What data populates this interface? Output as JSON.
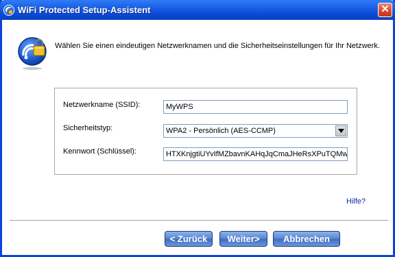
{
  "window": {
    "title": "WiFi Protected Setup-Assistent",
    "close_glyph": "✕"
  },
  "intro": {
    "text": "Wählen Sie einen eindeutigen Netzwerknamen und die Sicherheitseinstellungen für Ihr Netzwerk."
  },
  "form": {
    "ssid_label": "Netzwerkname (SSID):",
    "ssid_value": "MyWPS",
    "security_label": "Sicherheitstyp:",
    "security_value": "WPA2 - Persönlich (AES-CCMP)",
    "key_label": "Kennwort (Schlüssel):",
    "key_value": "HTXKnjgtiUYvIfMZbavnKAHqJqCmaJHeRsXPuTQMwT"
  },
  "help": {
    "label": "Hilfe?"
  },
  "buttons": {
    "back": "< Zurück",
    "next": "Weiter>",
    "cancel": "Abbrechen"
  },
  "colors": {
    "titlebar": "#0a4ad6",
    "border": "#0a45d8",
    "button": "#4f7fd0",
    "link": "#0b2ba6"
  },
  "icons": {
    "title": "wps-lock-icon",
    "main": "wps-lock-icon",
    "close": "close-icon",
    "dropdown": "chevron-down-icon"
  }
}
